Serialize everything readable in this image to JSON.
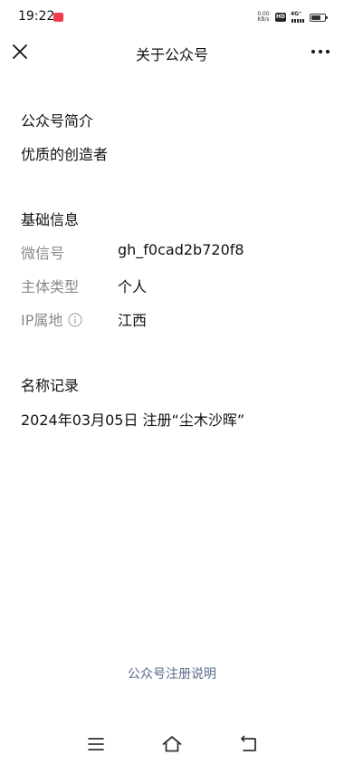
{
  "status_bar": {
    "time": "19:22",
    "net_speed_value": "0.00",
    "net_speed_unit": "KB/s",
    "hd_label": "HD",
    "network_label": "4G⁺"
  },
  "nav": {
    "title": "关于公众号"
  },
  "intro": {
    "heading": "公众号简介",
    "text": "优质的创造者"
  },
  "basic_info": {
    "heading": "基础信息",
    "rows": [
      {
        "label": "微信号",
        "value": "gh_f0cad2b720f8"
      },
      {
        "label": "主体类型",
        "value": "个人"
      },
      {
        "label": "IP属地",
        "value": "江西"
      }
    ]
  },
  "name_history": {
    "heading": "名称记录",
    "entry": "2024年03月05日 注册“尘木沙晖”"
  },
  "footer": {
    "link": "公众号注册说明"
  },
  "icons": {
    "close": "close-icon",
    "more": "more-icon",
    "info": "info-icon",
    "menu": "menu-icon",
    "home": "home-icon",
    "back": "back-icon"
  },
  "colors": {
    "label_gray": "#8a8a8a",
    "link_blue": "#5b6b8c",
    "text": "#111111"
  }
}
